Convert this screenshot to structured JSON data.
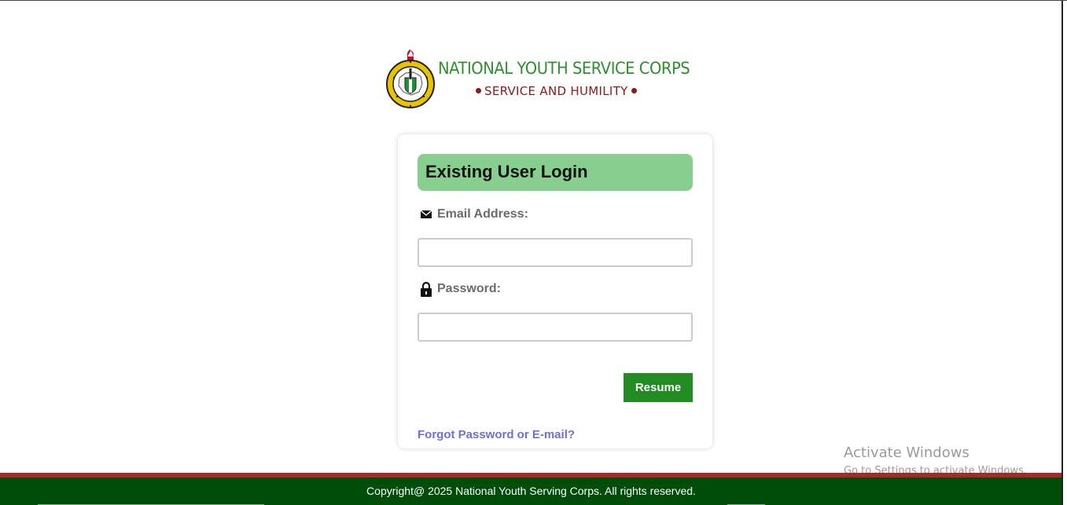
{
  "logo": {
    "title": "NATIONAL YOUTH SERVICE CORPS",
    "motto": "SERVICE AND HUMILITY",
    "emblem_icon": "nysc-emblem-icon",
    "colors": {
      "title": "#2f8f2f",
      "motto": "#8b1a1a"
    }
  },
  "login": {
    "title": "Existing User Login",
    "email_label": "Email Address:",
    "email_icon": "envelope-icon",
    "email_value": "",
    "password_label": "Password:",
    "password_icon": "lock-icon",
    "password_value": "",
    "submit_label": "Resume",
    "forgot_link": "Forgot Password or E-mail?",
    "colors": {
      "header_bg": "#88cf8f",
      "button_bg": "#228b22",
      "link": "#6f6fd8"
    }
  },
  "watermark": {
    "title": "Activate Windows",
    "subtitle": "Go to Settings to activate Windows."
  },
  "footer": {
    "text": "Copyright@ 2025 National Youth Serving Corps. All rights reserved.",
    "colors": {
      "stripe": "#a52a2a",
      "background": "#004d0a"
    }
  }
}
